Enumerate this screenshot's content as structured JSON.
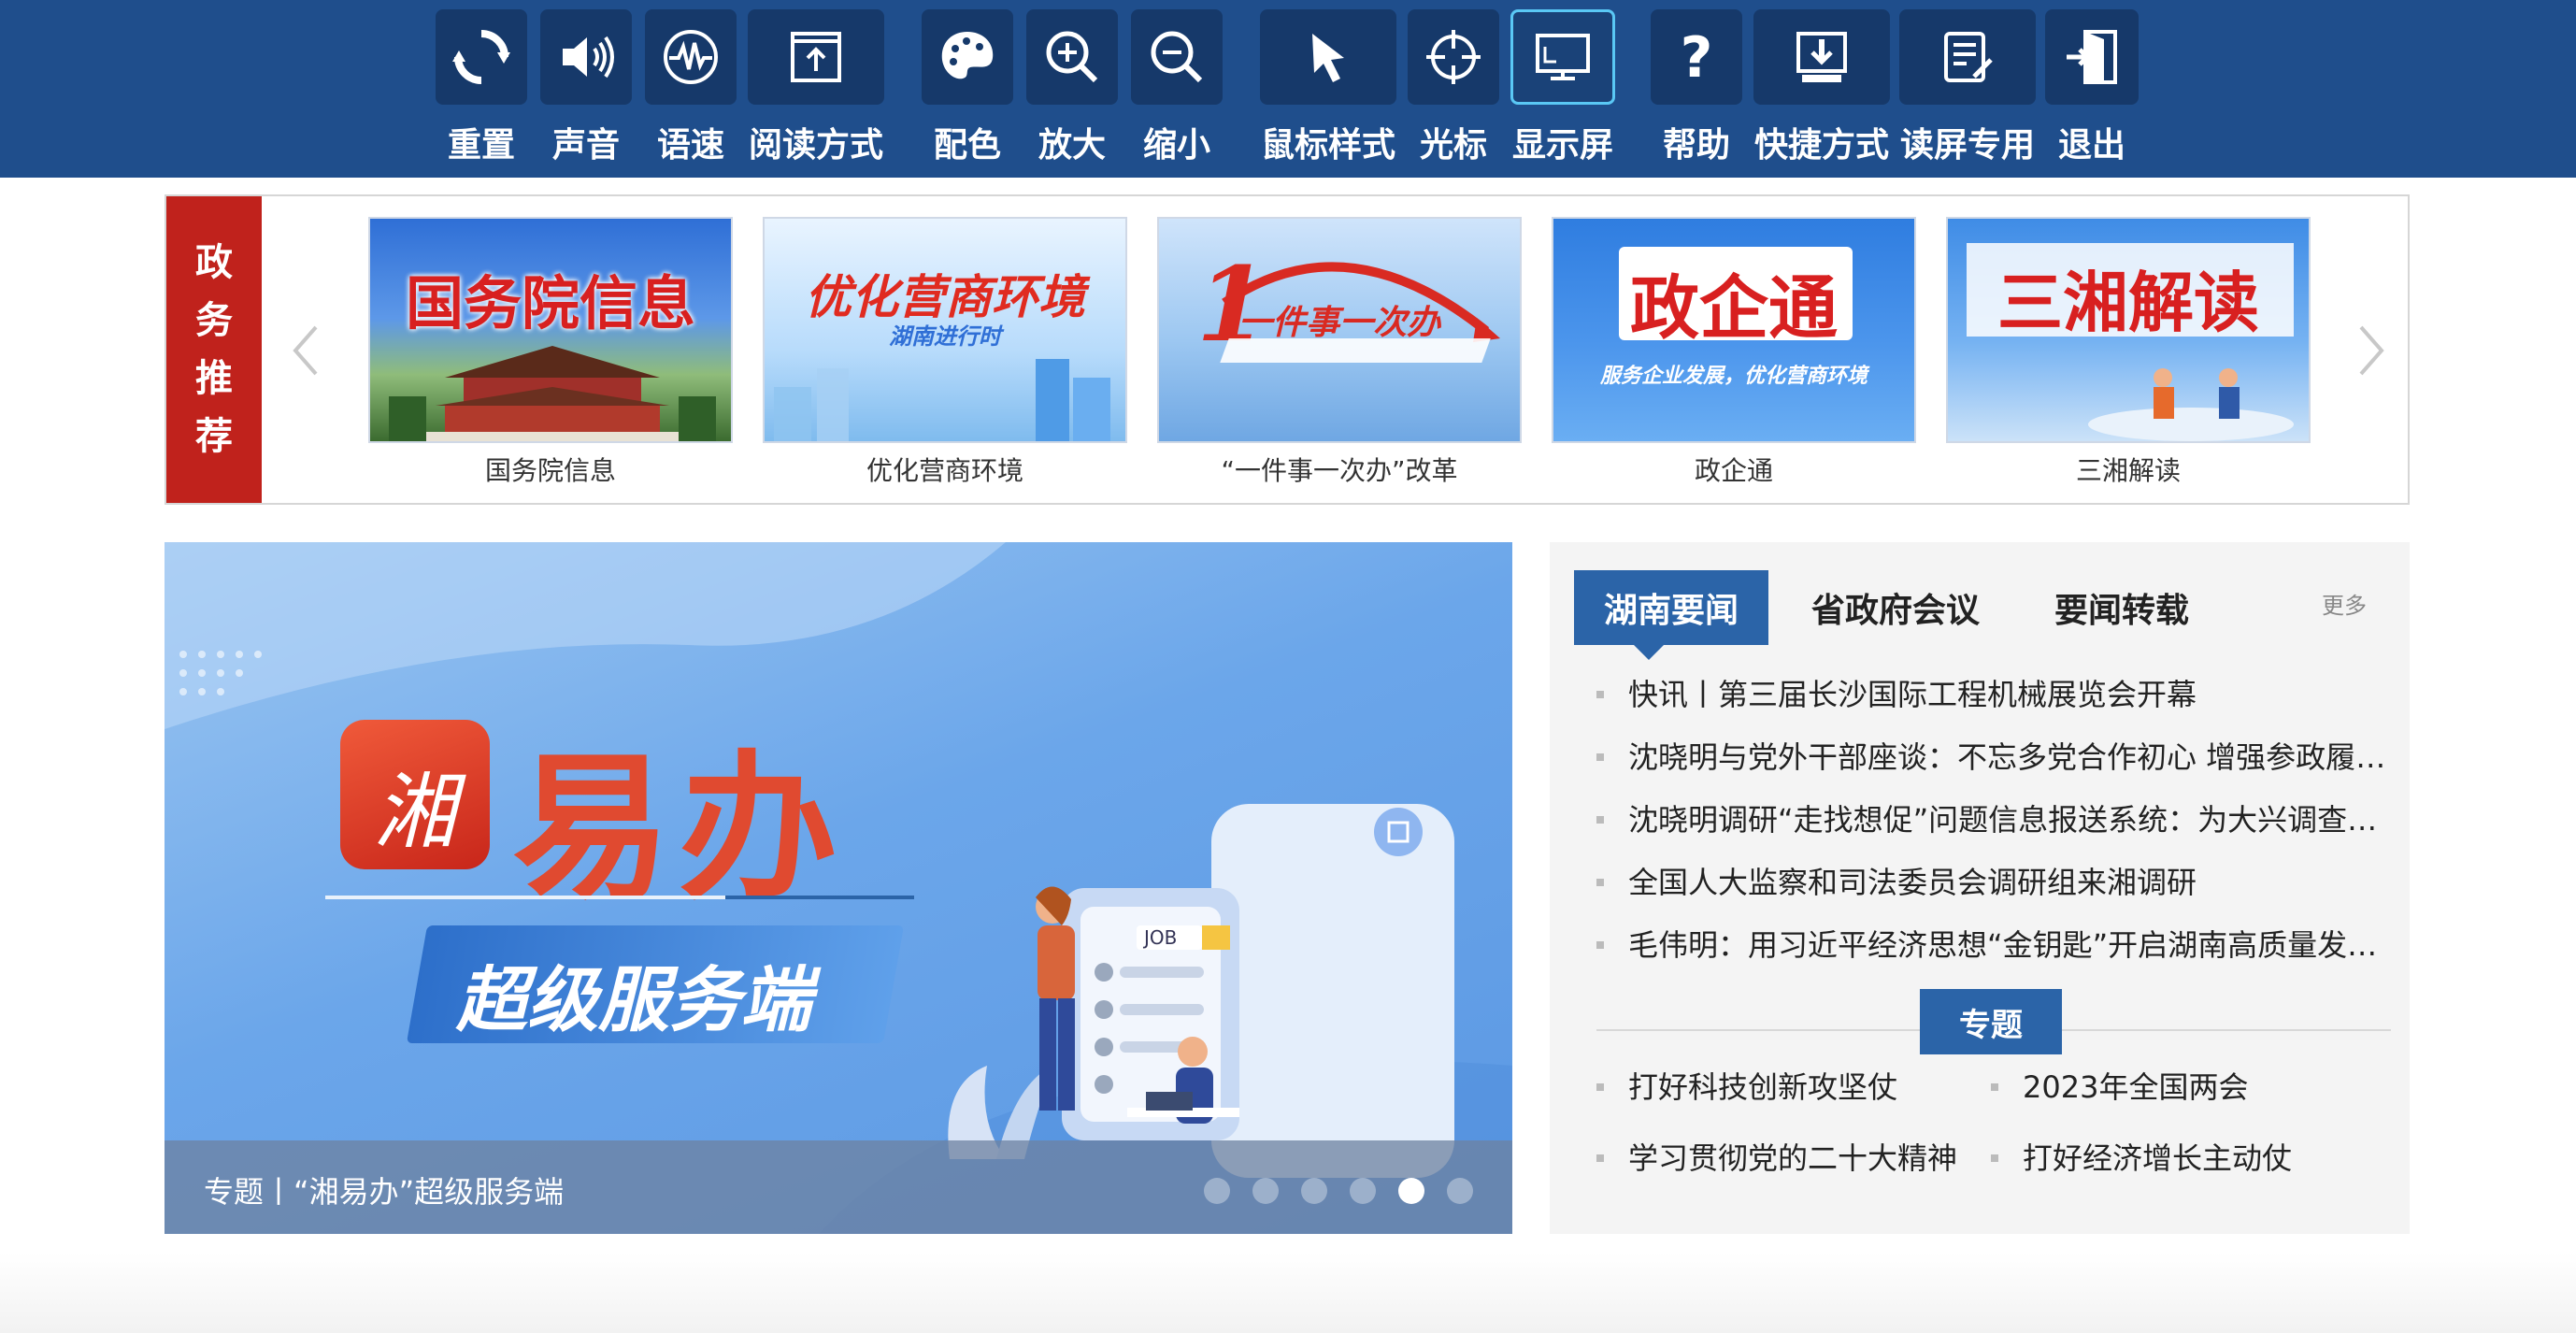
{
  "toolbar": {
    "buttons": [
      {
        "label": "重置",
        "icon": "refresh-icon"
      },
      {
        "label": "声音",
        "icon": "speaker-icon"
      },
      {
        "label": "语速",
        "icon": "waveform-icon"
      },
      {
        "label": "阅读方式",
        "icon": "upload-box-icon"
      },
      {
        "label": "配色",
        "icon": "palette-icon"
      },
      {
        "label": "放大",
        "icon": "zoom-in-icon"
      },
      {
        "label": "缩小",
        "icon": "zoom-out-icon"
      },
      {
        "label": "鼠标样式",
        "icon": "cursor-icon"
      },
      {
        "label": "光标",
        "icon": "crosshair-icon"
      },
      {
        "label": "显示屏",
        "icon": "monitor-icon"
      },
      {
        "label": "帮助",
        "icon": "help-icon"
      },
      {
        "label": "快捷方式",
        "icon": "download-icon"
      },
      {
        "label": "读屏专用",
        "icon": "document-edit-icon"
      },
      {
        "label": "退出",
        "icon": "exit-icon"
      }
    ],
    "active": "显示屏",
    "colors": {
      "background": "#1f4e8c",
      "icon_bg": "#16396a",
      "active_border": "#5ac8f5"
    }
  },
  "recommend": {
    "tag": [
      "政",
      "务",
      "推",
      "荐"
    ],
    "cards": [
      {
        "caption": "国务院信息",
        "banner": "国务院信息"
      },
      {
        "caption": "优化营商环境",
        "banner": "优化营商环境",
        "banner_sub": "湖南进行时"
      },
      {
        "caption": "“一件事一次办”改革",
        "banner": "一件事一次办"
      },
      {
        "caption": "政企通",
        "banner": "政企通",
        "banner_sub": "服务企业发展，优化营商环境"
      },
      {
        "caption": "三湘解读",
        "banner": "三湘解读"
      }
    ],
    "colors": {
      "tag_bg": "#c0221c"
    }
  },
  "hero": {
    "app_logo_text": "湘",
    "title": "易办",
    "subtitle": "超级服务端",
    "job_tag": "JOB",
    "caption": "专题丨“湘易办”超级服务端",
    "slide_count": 6,
    "active_slide": 5
  },
  "news": {
    "tabs": [
      "湖南要闻",
      "省政府会议",
      "要闻转载"
    ],
    "active_tab": "湖南要闻",
    "more": "更多",
    "items": [
      "快讯丨第三届长沙国际工程机械展览会开幕",
      "沈晓明与党外干部座谈：不忘多党合作初心 增强参政履职…",
      "沈晓明调研“走找想促”问题信息报送系统：为大兴调查研…",
      "全国人大监察和司法委员会调研组来湘调研",
      "毛伟明：用习近平经济思想“金钥匙”开启湖南高质量发展…"
    ],
    "topic_label": "专题",
    "topics": [
      "打好科技创新攻坚仗",
      "2023年全国两会",
      "学习贯彻党的二十大精神",
      "打好经济增长主动仗"
    ],
    "colors": {
      "accent": "#2b64a8",
      "panel_bg": "#f4f4f4"
    }
  }
}
